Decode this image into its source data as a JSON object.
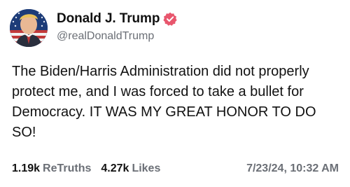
{
  "author": {
    "display_name": "Donald J. Trump",
    "handle": "@realDonaldTrump",
    "verified": true,
    "avatar_icon": "avatar-portrait-flag"
  },
  "post": {
    "text": "The Biden/Harris Administration did not properly protect me, and I was forced to take a bullet for Democracy. IT WAS MY GREAT HONOR TO DO SO!"
  },
  "stats": {
    "retruths_count": "1.19k",
    "retruths_label": "ReTruths",
    "likes_count": "4.27k",
    "likes_label": "Likes",
    "timestamp": "7/23/24, 10:32 AM"
  },
  "colors": {
    "verified_badge": "#e8566d",
    "secondary_text": "#6b6f76",
    "primary_text": "#111111"
  }
}
